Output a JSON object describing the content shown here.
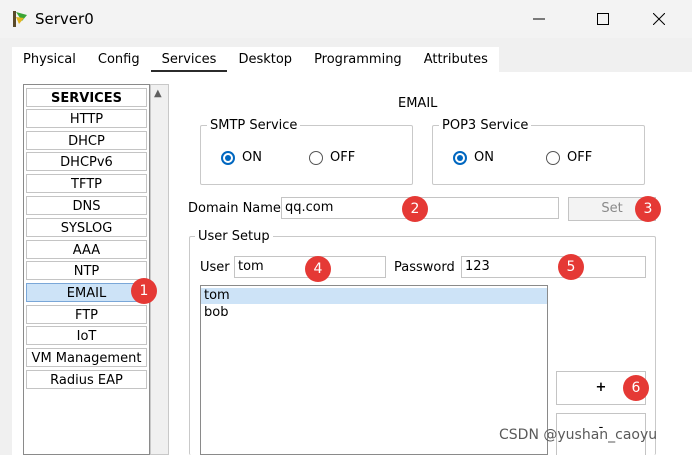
{
  "window": {
    "title": "Server0",
    "minimize_icon": "minimize-icon",
    "maximize_icon": "maximize-icon",
    "close_icon": "close-icon"
  },
  "tabs": [
    {
      "label": "Physical"
    },
    {
      "label": "Config"
    },
    {
      "label": "Services",
      "active": true
    },
    {
      "label": "Desktop"
    },
    {
      "label": "Programming"
    },
    {
      "label": "Attributes"
    }
  ],
  "services": {
    "header": "SERVICES",
    "items": [
      "HTTP",
      "DHCP",
      "DHCPv6",
      "TFTP",
      "DNS",
      "SYSLOG",
      "AAA",
      "NTP",
      "EMAIL",
      "FTP",
      "IoT",
      "VM Management",
      "Radius EAP"
    ],
    "selected": "EMAIL"
  },
  "email": {
    "title": "EMAIL",
    "smtp": {
      "legend": "SMTP Service",
      "on_label": "ON",
      "off_label": "OFF",
      "value": "ON"
    },
    "pop3": {
      "legend": "POP3 Service",
      "on_label": "ON",
      "off_label": "OFF",
      "value": "ON"
    },
    "domain_label": "Domain Name:",
    "domain_value": "qq.com",
    "set_label": "Set",
    "user_setup": {
      "legend": "User Setup",
      "user_label": "User",
      "user_value": "tom",
      "password_label": "Password",
      "password_value": "123",
      "users": [
        "tom",
        "bob"
      ],
      "selected_user": "tom",
      "add_label": "+",
      "remove_label": "-"
    }
  },
  "annotations": [
    "1",
    "2",
    "3",
    "4",
    "5",
    "6"
  ],
  "watermark": "CSDN @yushan_caoyu",
  "colors": {
    "accent": "#0067c0",
    "selected_bg": "#cde3f7",
    "badge": "#e53935"
  }
}
